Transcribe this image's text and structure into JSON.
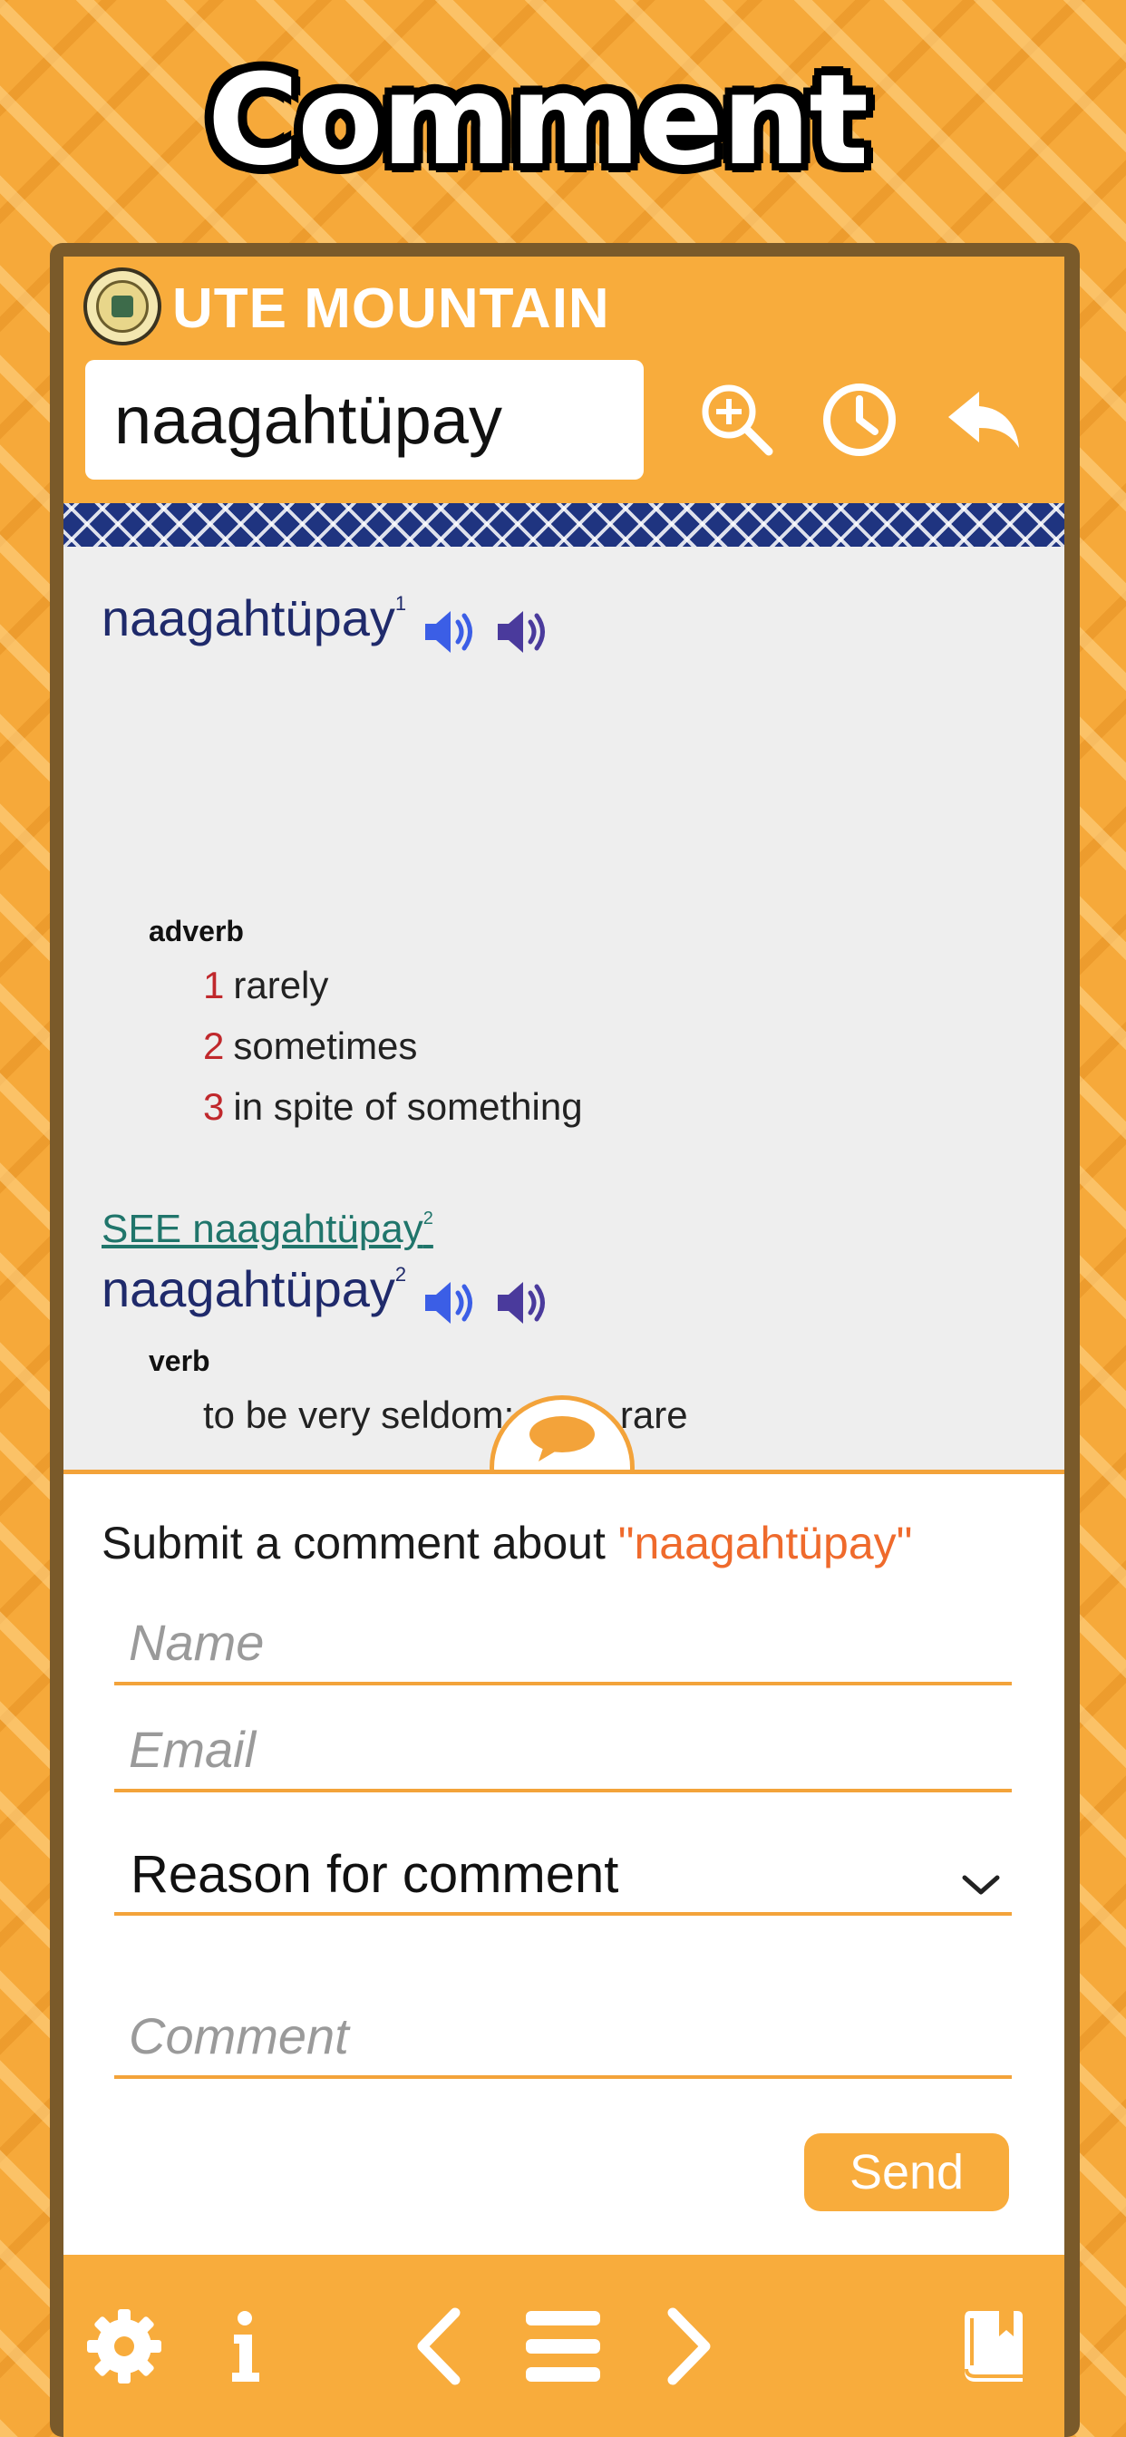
{
  "promo": {
    "title": "Comment"
  },
  "app": {
    "brand": "UTE MOUNTAIN",
    "search": {
      "value": "naagahtüpay"
    }
  },
  "header_icons": [
    "zoom-in-icon",
    "history-clock-icon",
    "back-arrow-icon"
  ],
  "entries": [
    {
      "headword": "naagahtüpay",
      "homonym": "1",
      "pos": "adverb",
      "senses": [
        {
          "num": "1",
          "text": "rarely"
        },
        {
          "num": "2",
          "text": "sometimes"
        },
        {
          "num": "3",
          "text": "in spite of something"
        }
      ]
    },
    {
      "see_prefix": "SEE naagahtüpay",
      "see_homonym": "2",
      "headword": "naagahtüpay",
      "homonym": "2",
      "pos": "verb",
      "senses": [
        {
          "num": "",
          "text": "to be very seldom; to be rare"
        }
      ]
    }
  ],
  "form": {
    "prompt": "Submit a comment about ",
    "quoted_word": "\"naagahtüpay\"",
    "name_placeholder": "Name",
    "email_placeholder": "Email",
    "reason_value": "Reason for comment",
    "comment_placeholder": "Comment",
    "send_label": "Send"
  },
  "footer_icons": [
    "settings-gear-icon",
    "info-icon",
    "previous-chevron-icon",
    "menu-icon",
    "next-chevron-icon",
    "bookmarks-icon"
  ],
  "colors": {
    "accent_orange": "#f8ac3c",
    "headword_navy": "#1f2a6b",
    "sense_number_red": "#c0282c",
    "link_teal": "#20756b",
    "quoted_word_orange": "#ef6a2c",
    "speaker_blue": "#3b5ee6",
    "speaker_purple": "#4a3a9c"
  }
}
